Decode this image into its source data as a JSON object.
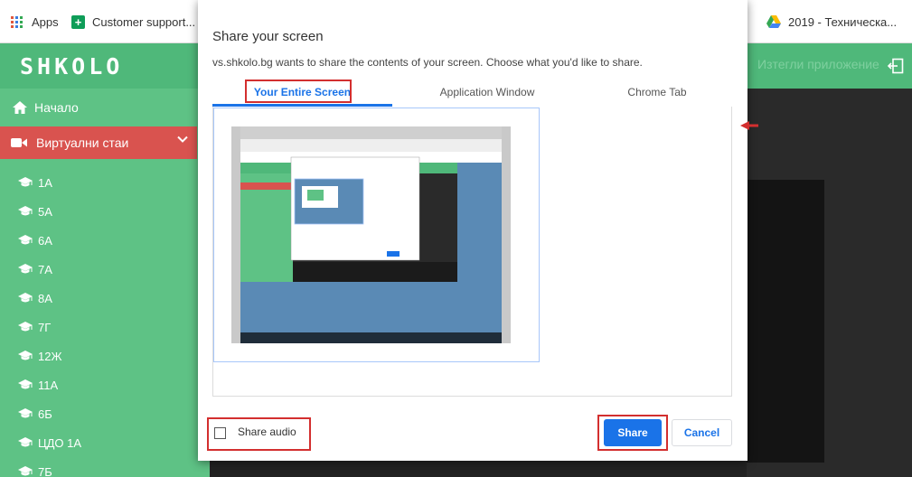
{
  "bookmarks": {
    "apps": "Apps",
    "customer_support": "Customer support...",
    "tech_item": "2019 - Техническа..."
  },
  "app": {
    "logo": "SHKOLO",
    "header_right": "Изтегли приложение"
  },
  "sidebar": {
    "home": "Начало",
    "virtual_rooms": "Виртуални стаи",
    "classes": [
      "1А",
      "5А",
      "6А",
      "7А",
      "8А",
      "7Г",
      "12Ж",
      "11А",
      "6Б",
      "ЦДО 1А",
      "7Б"
    ]
  },
  "dialog": {
    "title": "Share your screen",
    "subtitle": "vs.shkolo.bg wants to share the contents of your screen. Choose what you'd like to share.",
    "tabs": [
      {
        "label": "Your Entire Screen",
        "active": true
      },
      {
        "label": "Application Window",
        "active": false
      },
      {
        "label": "Chrome Tab",
        "active": false
      }
    ],
    "share_audio": "Share audio",
    "share_button": "Share",
    "cancel_button": "Cancel"
  },
  "colors": {
    "brand_green": "#4fb87a",
    "active_red": "#d9534f",
    "accent_blue": "#1a73e8",
    "annotation_red": "#d32f2f"
  }
}
